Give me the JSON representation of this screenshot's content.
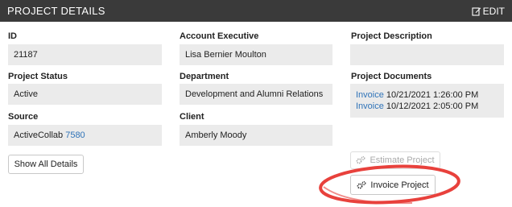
{
  "header": {
    "title": "PROJECT DETAILS",
    "edit_label": "EDIT"
  },
  "fields": {
    "id": {
      "label": "ID",
      "value": "21187"
    },
    "project_status": {
      "label": "Project Status",
      "value": "Active"
    },
    "source": {
      "label": "Source",
      "value": "ActiveCollab",
      "link": "7580"
    },
    "account_executive": {
      "label": "Account Executive",
      "value": "Lisa Bernier Moulton"
    },
    "department": {
      "label": "Department",
      "value": "Development and Alumni Relations"
    },
    "client": {
      "label": "Client",
      "value": "Amberly Moody"
    },
    "project_description": {
      "label": "Project Description",
      "value": ""
    },
    "project_documents": {
      "label": "Project Documents",
      "items": [
        {
          "link": "Invoice",
          "date": "10/21/2021 1:26:00 PM"
        },
        {
          "link": "Invoice",
          "date": "10/12/2021 2:05:00 PM"
        }
      ]
    }
  },
  "buttons": {
    "show_all": "Show All Details",
    "estimate": "Estimate Project",
    "invoice": "Invoice Project"
  },
  "colors": {
    "header_bg": "#3a3a3a",
    "field_bg": "#ebebeb",
    "link": "#2f73b8",
    "annotation": "#e8413c"
  }
}
